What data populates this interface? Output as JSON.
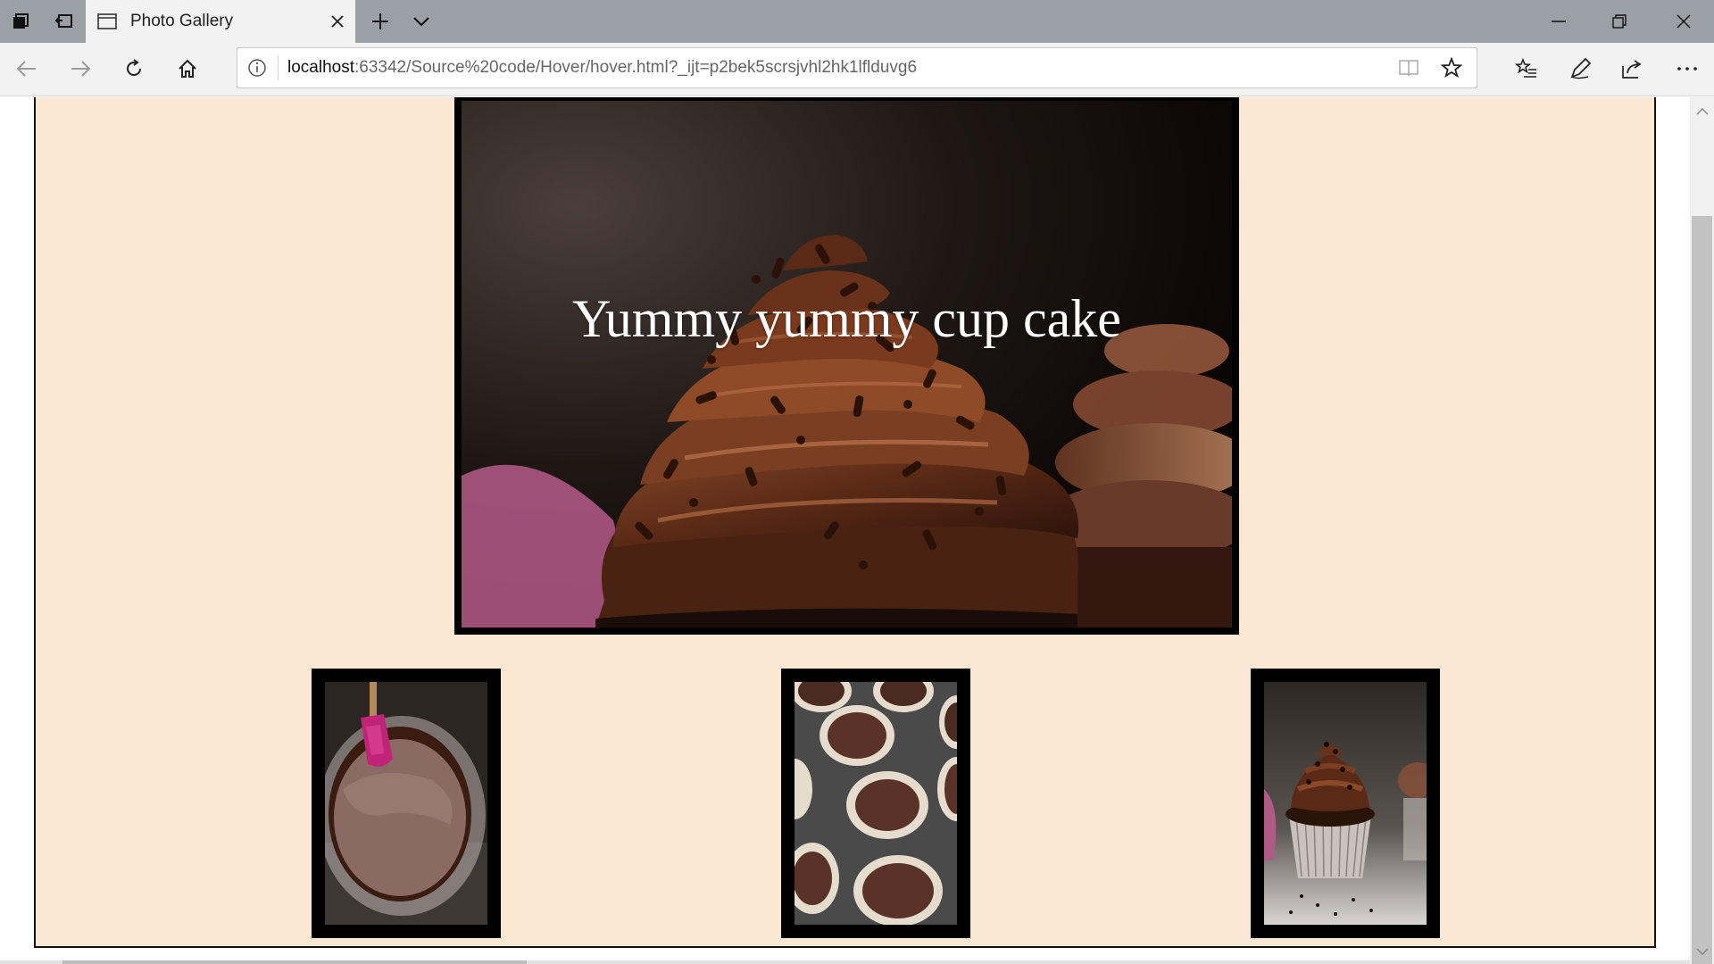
{
  "browser": {
    "tab": {
      "title": "Photo Gallery"
    },
    "address": {
      "host": "localhost",
      "rest": ":63342/Source%20code/Hover/hover.html?_ijt=p2bek5scrsjvhl2hk1lflduvg6"
    },
    "icons": {
      "tab_actions": [
        "tabs-aside-icon",
        "set-aside-tabs-icon"
      ],
      "new_tab": "plus-icon",
      "tab_list": "chevron-down-icon",
      "window": [
        "minimize-icon",
        "restore-icon",
        "close-icon"
      ],
      "nav": [
        "back-icon",
        "forward-icon",
        "refresh-icon",
        "home-icon"
      ],
      "address": [
        "info-icon",
        "reading-view-icon",
        "favorite-star-icon"
      ],
      "toolbar": [
        "favorites-list-icon",
        "pen-icon",
        "share-icon",
        "more-icon"
      ]
    }
  },
  "page": {
    "hero_caption": "Yummy yummy cup cake",
    "background_color": "#fae8d3",
    "frame_color": "#000000",
    "thumbnails": [
      {
        "name": "batter-bowl-thumbnail",
        "subject": "bowl of chocolate batter with pink spatula"
      },
      {
        "name": "muffin-tin-thumbnail",
        "subject": "muffin tin with batter-filled paper liners"
      },
      {
        "name": "cupcake-thumbnail",
        "subject": "chocolate frosted cupcake with sprinkles"
      }
    ]
  }
}
